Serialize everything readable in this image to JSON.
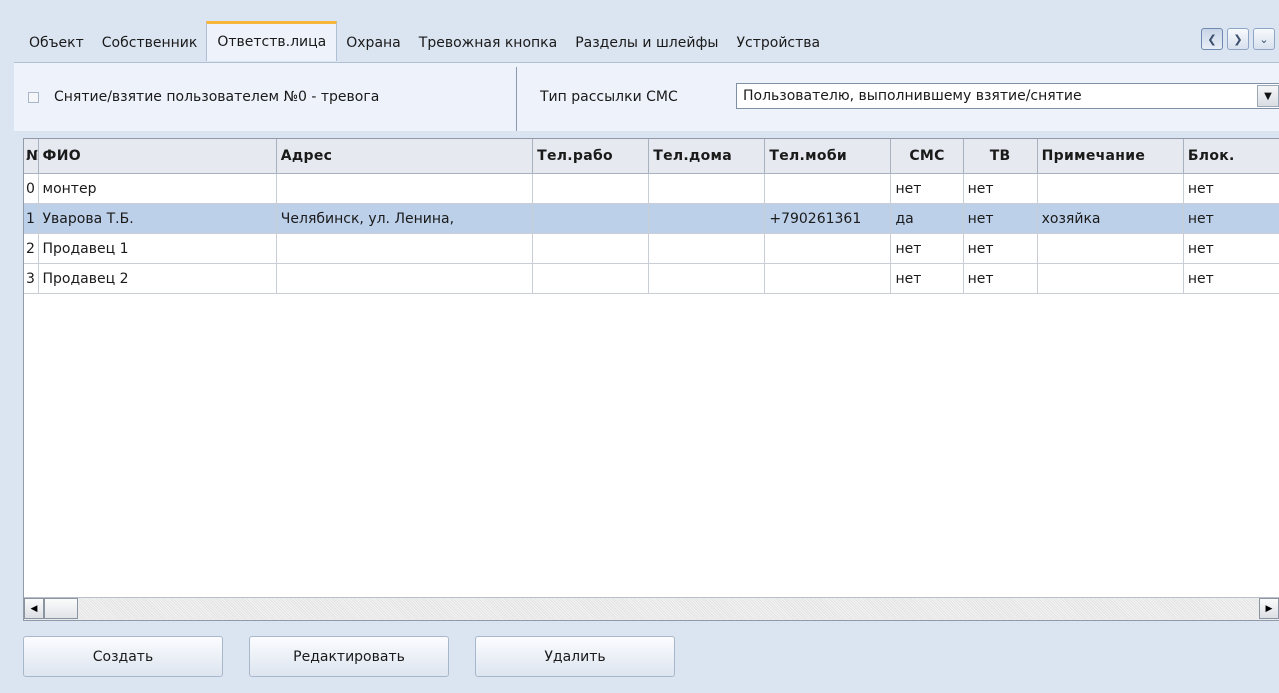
{
  "tabs": [
    {
      "label": "Объект"
    },
    {
      "label": "Собственник"
    },
    {
      "label": "Ответств.лица",
      "active": true
    },
    {
      "label": "Охрана"
    },
    {
      "label": "Тревожная кнопка"
    },
    {
      "label": "Разделы и шлейфы"
    },
    {
      "label": "Устройства"
    }
  ],
  "nav_icons": [
    "chevron-left-icon",
    "chevron-right-icon",
    "chevron-down-icon"
  ],
  "options": {
    "checkbox_label": "Снятие/взятие пользователем №0 - тревога",
    "checkbox_checked": false,
    "sms_type_label": "Тип рассылки СМС",
    "sms_type_value": "Пользователю, выполнившему взятие/снятие"
  },
  "grid": {
    "columns": [
      "№",
      "ФИО",
      "Адрес",
      "Тел.рабо",
      "Тел.дома",
      "Тел.моби",
      "СМС",
      "ТВ",
      "Примечание",
      "Блок."
    ],
    "rows": [
      [
        "0",
        "монтер",
        "",
        "",
        "",
        "",
        "нет",
        "нет",
        "",
        "нет"
      ],
      [
        "1",
        "Уварова Т.Б.",
        "Челябинск, ул. Ленина,",
        "",
        "",
        "+790261361",
        "да",
        "нет",
        "хозяйка",
        "нет"
      ],
      [
        "2",
        "Продавец 1",
        "",
        "",
        "",
        "",
        "нет",
        "нет",
        "",
        "нет"
      ],
      [
        "3",
        "Продавец 2",
        "",
        "",
        "",
        "",
        "нет",
        "нет",
        "",
        "нет"
      ]
    ],
    "selected_row": 1
  },
  "buttons": {
    "create": "Создать",
    "edit": "Редактировать",
    "delete": "Удалить"
  },
  "colors": {
    "background": "#dbe4f1",
    "active_tab_accent": "#f6b73a",
    "selected_row": "#bdd0ea"
  }
}
